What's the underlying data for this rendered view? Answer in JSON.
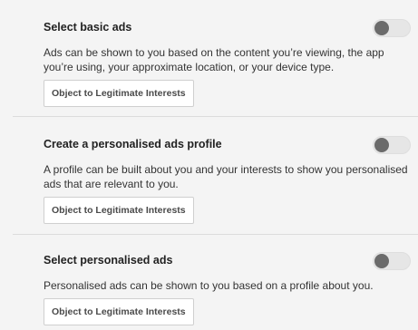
{
  "sections": [
    {
      "title": "Select basic ads",
      "description": "Ads can be shown to you based on the content you’re viewing, the app you’re using, your approximate location, or your device type.",
      "button_label": "Object to Legitimate Interests",
      "toggle_on": false
    },
    {
      "title": "Create a personalised ads profile",
      "description": "A profile can be built about you and your interests to show you personalised ads that are relevant to you.",
      "button_label": "Object to Legitimate Interests",
      "toggle_on": false
    },
    {
      "title": "Select personalised ads",
      "description": "Personalised ads can be shown to you based on a profile about you.",
      "button_label": "Object to Legitimate Interests",
      "toggle_on": false
    }
  ],
  "colors": {
    "background": "#f4f4f4",
    "toggle_track": "#e6e6e6",
    "toggle_knob": "#6b6b6b",
    "divider": "#dcdcdc"
  }
}
